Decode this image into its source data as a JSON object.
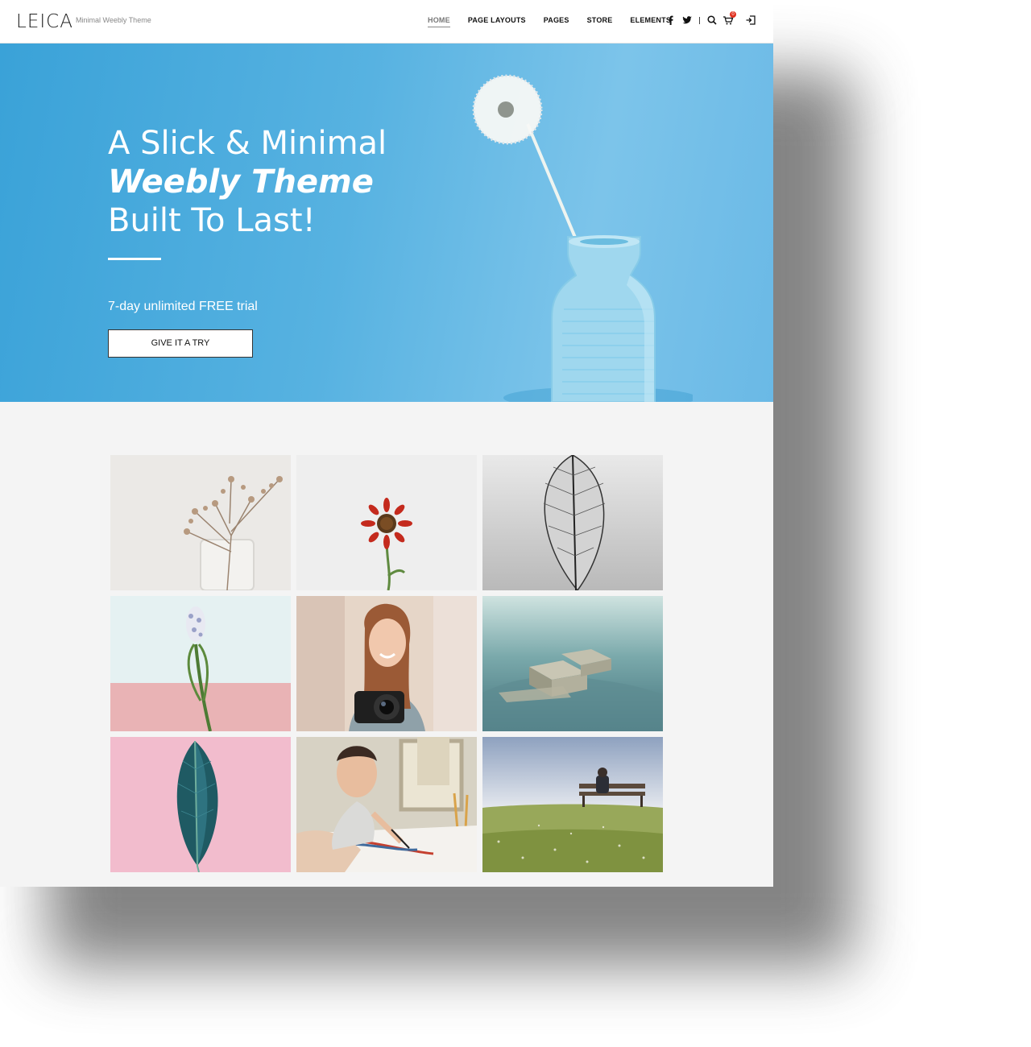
{
  "header": {
    "logo": "LEICA",
    "tagline": "Minimal Weebly Theme",
    "nav": [
      "HOME",
      "PAGE LAYOUTS",
      "PAGES",
      "STORE",
      "ELEMENTS"
    ],
    "active_nav": "HOME",
    "icons": [
      "facebook-icon",
      "twitter-icon",
      "search-icon",
      "cart-icon",
      "login-icon"
    ],
    "cart_count": "0"
  },
  "hero": {
    "title_line1": "A Slick & Minimal",
    "title_line2": "Weebly Theme",
    "title_line3": "Built To Last!",
    "subtitle": "7-day unlimited FREE trial",
    "cta_label": "GIVE IT A TRY",
    "background_color": "#4fade0"
  },
  "gallery": {
    "tiles": [
      "dried-flowers-jar",
      "red-flower",
      "skeleton-leaf",
      "hyacinth-flower",
      "woman-with-camera",
      "rocks-on-shore",
      "teal-leaf-pink",
      "man-painting",
      "man-on-bench"
    ]
  },
  "colors": {
    "accent": "#e0301e",
    "text_dark": "#111111",
    "page_bg": "#f4f4f4"
  }
}
